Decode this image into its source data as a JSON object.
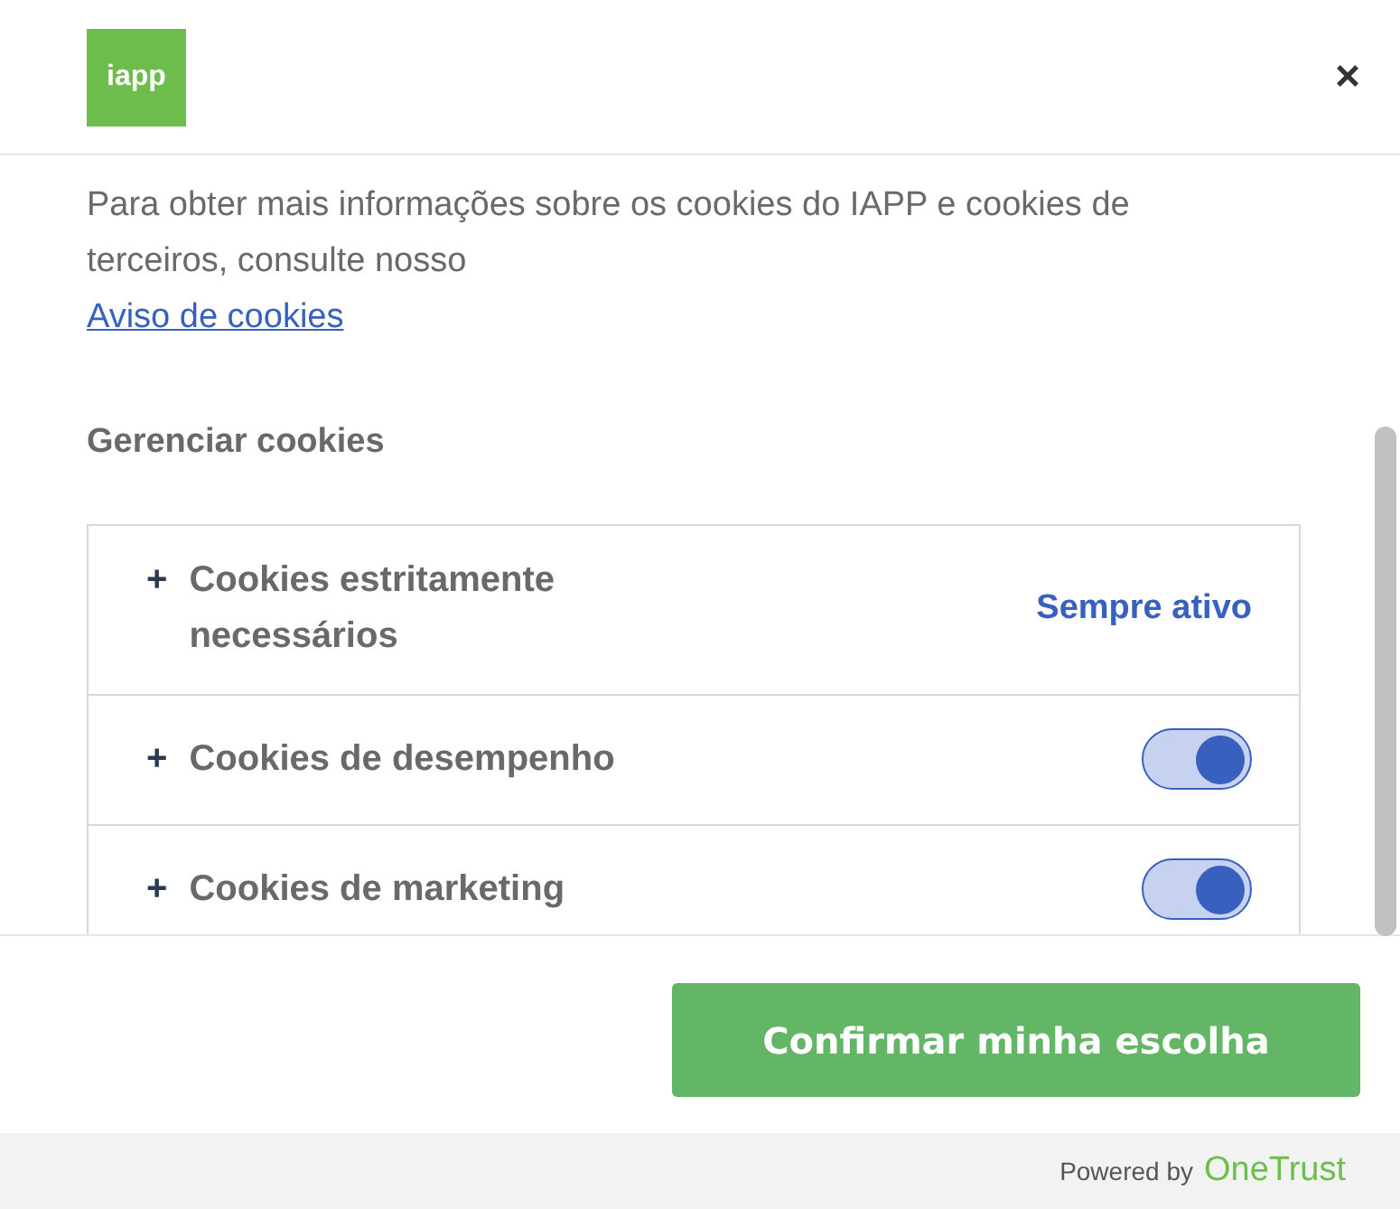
{
  "header": {
    "logo": "iapp",
    "close": "×"
  },
  "intro": {
    "text": "Para obter mais informações sobre os cookies do IAPP e cookies de terceiros, consulte nosso",
    "link": "Aviso de cookies"
  },
  "section_title": "Gerenciar cookies",
  "categories": [
    {
      "kind": "always",
      "expand": "+",
      "label": "Cookies estritamente necessários",
      "status": "Sempre ativo"
    },
    {
      "kind": "toggle",
      "expand": "+",
      "label": "Cookies de desempenho",
      "on": true
    },
    {
      "kind": "toggle",
      "expand": "+",
      "label": "Cookies de marketing",
      "on": true
    }
  ],
  "confirm_button": "Confirmar minha escolha",
  "footer": {
    "powered_by": "Powered by",
    "brand": "OneTrust"
  }
}
